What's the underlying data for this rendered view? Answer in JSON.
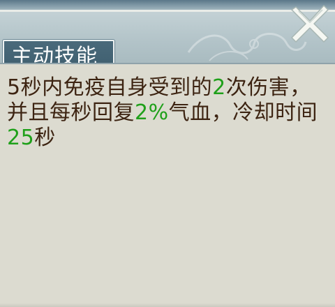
{
  "header": {
    "title": "主动技能"
  },
  "description": {
    "segments": [
      {
        "text": "5秒内免疫自身受到的",
        "highlight": false
      },
      {
        "text": "2",
        "highlight": true
      },
      {
        "text": "次伤害，并且每秒回复",
        "highlight": false
      },
      {
        "text": "2%",
        "highlight": true
      },
      {
        "text": "气血，冷却时间",
        "highlight": false
      },
      {
        "text": "25",
        "highlight": true
      },
      {
        "text": "秒",
        "highlight": false
      }
    ]
  },
  "colors": {
    "header_bg": "#b2c3c8",
    "title_box_bg": "#3d5d6d",
    "body_bg": "#dcdbd0",
    "text": "#3d2412",
    "highlight": "#1fa01a"
  },
  "icons": {
    "close": "close-icon"
  }
}
